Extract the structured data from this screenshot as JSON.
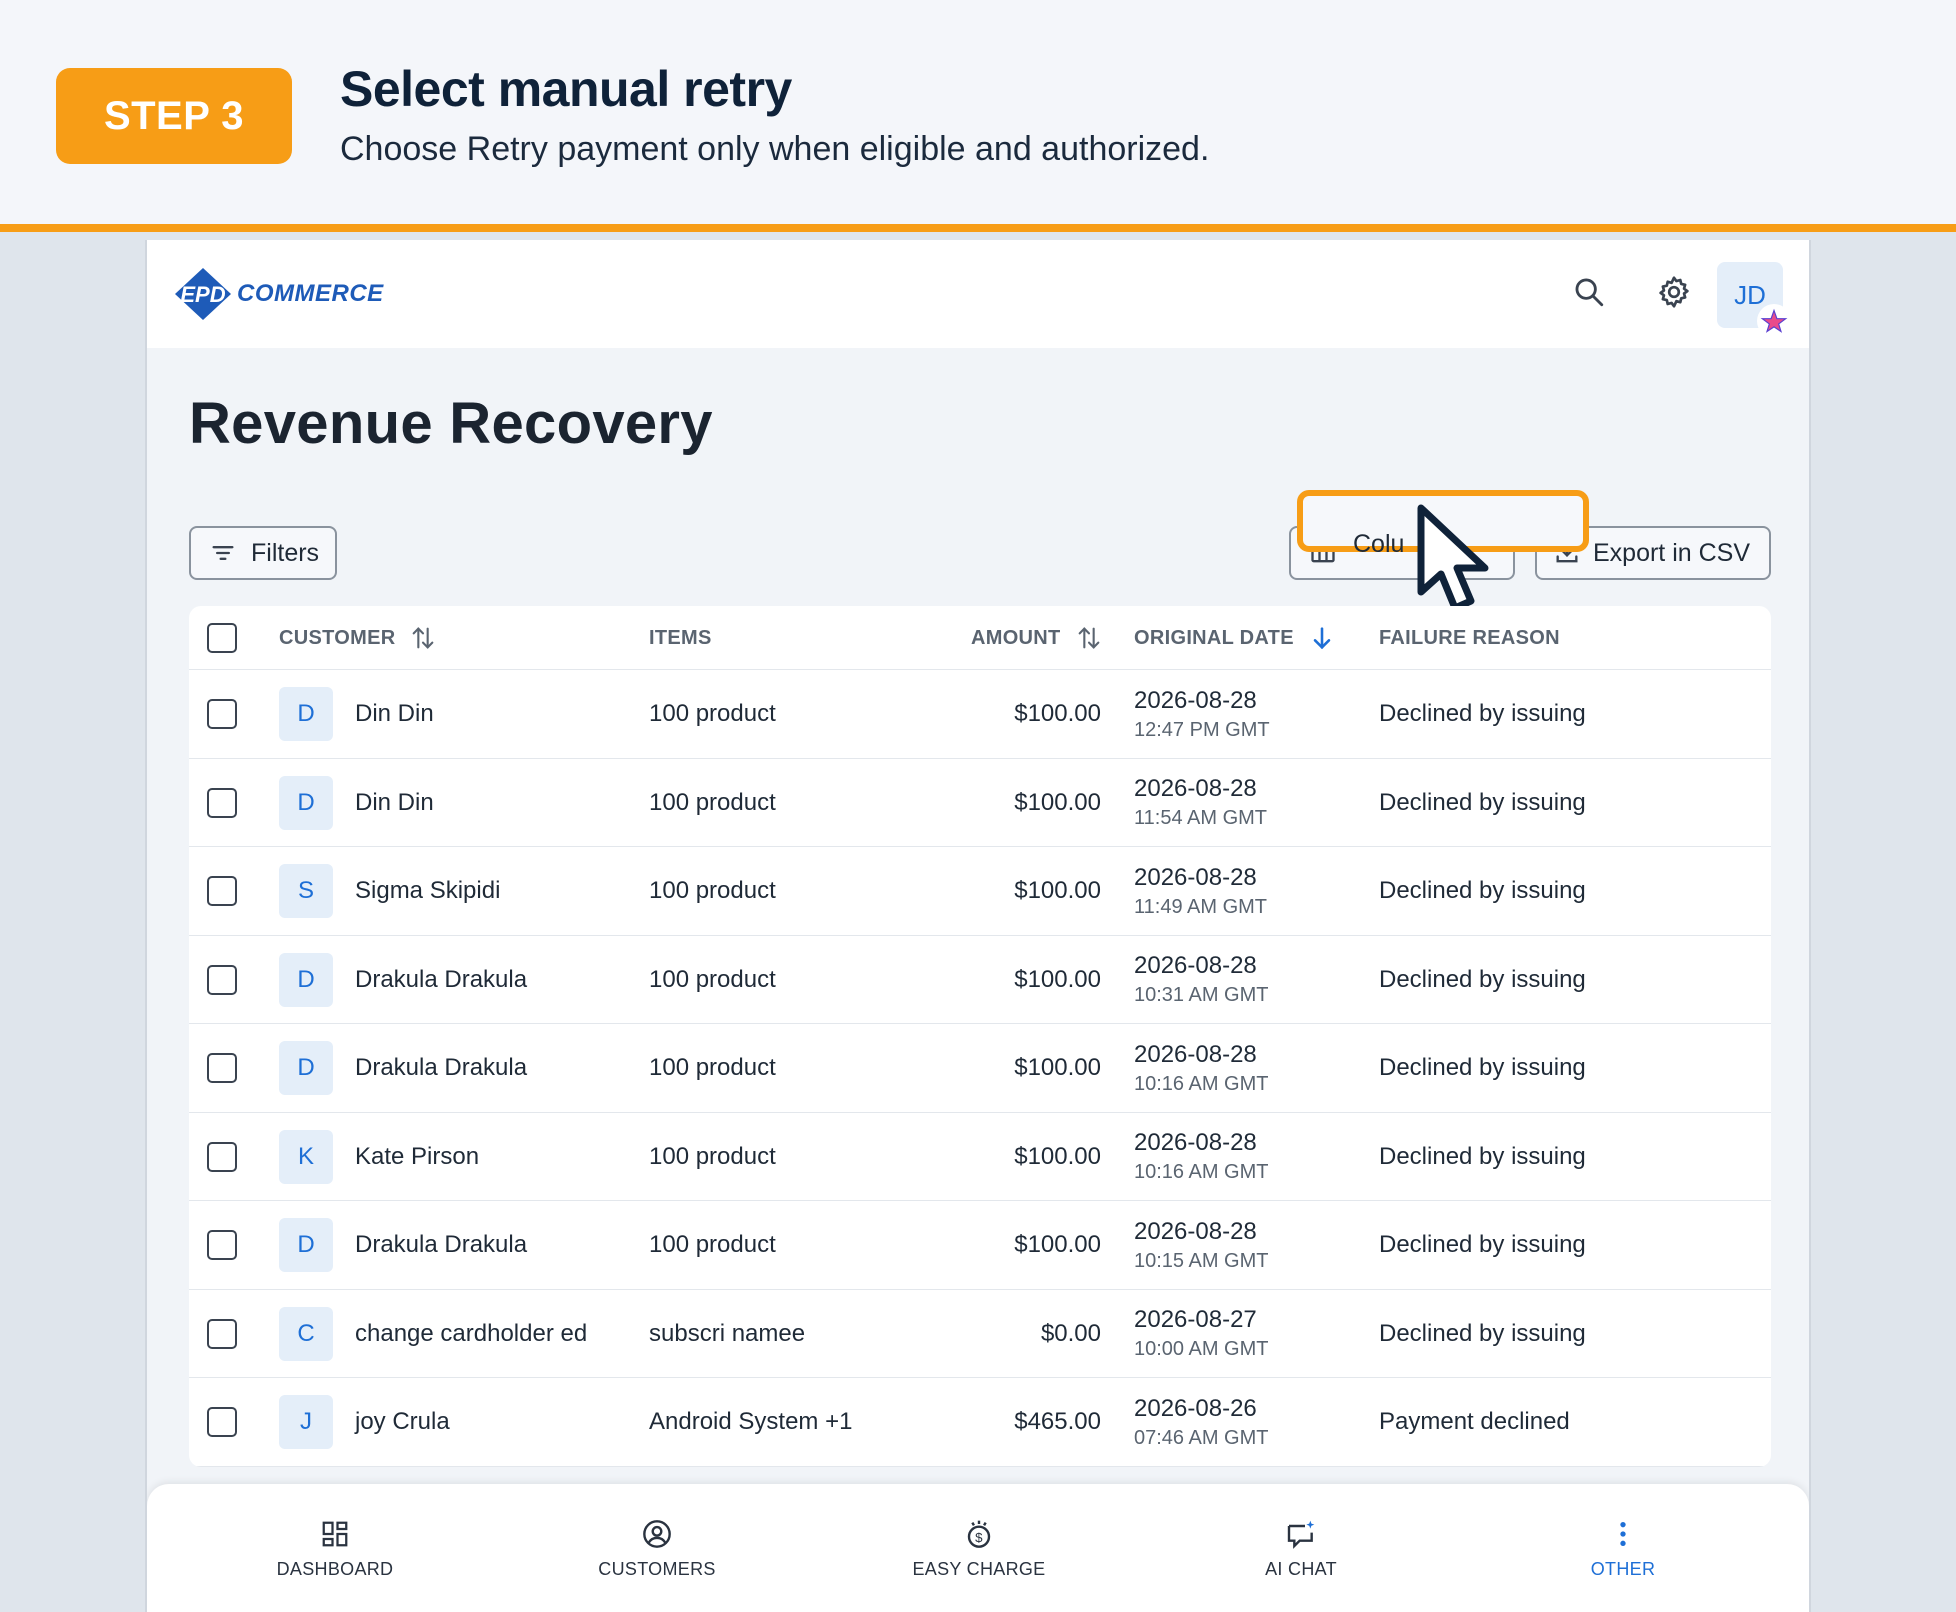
{
  "banner": {
    "step_label": "STEP 3",
    "title": "Select manual retry",
    "subtitle": "Choose Retry payment only when eligible and authorized."
  },
  "brand": {
    "logo_mark": "EPD",
    "logo_text": "COMMERCE",
    "accent": "#f79d16",
    "primary": "#1e6fd6"
  },
  "header": {
    "avatar_initials": "JD"
  },
  "page": {
    "title": "Revenue Recovery"
  },
  "toolbar": {
    "filters_label": "Filters",
    "columns_label_partial": "Colu",
    "export_label": "Export in CSV"
  },
  "table": {
    "headers": {
      "customer": "CUSTOMER",
      "items": "ITEMS",
      "amount": "AMOUNT",
      "original_date": "ORIGINAL DATE",
      "failure_reason": "FAILURE REASON"
    },
    "rows": [
      {
        "initial": "D",
        "customer": "Din Din",
        "items": "100 product",
        "amount": "$100.00",
        "date": "2026-08-28",
        "time": "12:47 PM GMT",
        "reason": "Declined by issuing"
      },
      {
        "initial": "D",
        "customer": "Din Din",
        "items": "100 product",
        "amount": "$100.00",
        "date": "2026-08-28",
        "time": "11:54 AM GMT",
        "reason": "Declined by issuing"
      },
      {
        "initial": "S",
        "customer": "Sigma Skipidi",
        "items": "100 product",
        "amount": "$100.00",
        "date": "2026-08-28",
        "time": "11:49 AM GMT",
        "reason": "Declined by issuing"
      },
      {
        "initial": "D",
        "customer": "Drakula Drakula",
        "items": "100 product",
        "amount": "$100.00",
        "date": "2026-08-28",
        "time": "10:31 AM GMT",
        "reason": "Declined by issuing"
      },
      {
        "initial": "D",
        "customer": "Drakula Drakula",
        "items": "100 product",
        "amount": "$100.00",
        "date": "2026-08-28",
        "time": "10:16 AM GMT",
        "reason": "Declined by issuing"
      },
      {
        "initial": "K",
        "customer": "Kate Pirson",
        "items": "100 product",
        "amount": "$100.00",
        "date": "2026-08-28",
        "time": "10:16 AM GMT",
        "reason": "Declined by issuing"
      },
      {
        "initial": "D",
        "customer": "Drakula Drakula",
        "items": "100 product",
        "amount": "$100.00",
        "date": "2026-08-28",
        "time": "10:15 AM GMT",
        "reason": "Declined by issuing"
      },
      {
        "initial": "C",
        "customer": "change cardholder ed",
        "items": "subscri namee",
        "amount": "$0.00",
        "date": "2026-08-27",
        "time": "10:00 AM GMT",
        "reason": "Declined by issuing"
      },
      {
        "initial": "J",
        "customer": "joy Crula",
        "items": "Android System +1",
        "amount": "$465.00",
        "date": "2026-08-26",
        "time": "07:46 AM GMT",
        "reason": "Payment declined"
      }
    ]
  },
  "bottom_nav": {
    "items": [
      {
        "label": "DASHBOARD",
        "icon": "dashboard-icon"
      },
      {
        "label": "CUSTOMERS",
        "icon": "customers-icon"
      },
      {
        "label": "EASY CHARGE",
        "icon": "easy-charge-icon"
      },
      {
        "label": "AI CHAT",
        "icon": "ai-chat-icon"
      },
      {
        "label": "OTHER",
        "icon": "more-vertical-icon"
      }
    ]
  }
}
